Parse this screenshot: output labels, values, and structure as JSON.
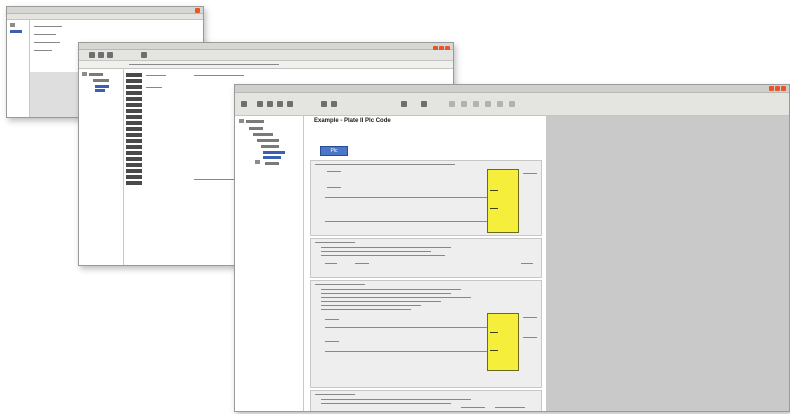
{
  "front_window": {
    "page_title": "Example - Plate II Plc Code",
    "button_label": "Plc"
  },
  "icons": {
    "close": "window-close-icon",
    "maximize": "window-maximize-icon",
    "minimize": "window-minimize-icon",
    "folder": "folder-icon"
  },
  "colors": {
    "function_block": "#f5ef3c",
    "selection": "#3b5fb5",
    "window_controls": "#e8552a",
    "panel_gray": "#c9c9c9"
  }
}
